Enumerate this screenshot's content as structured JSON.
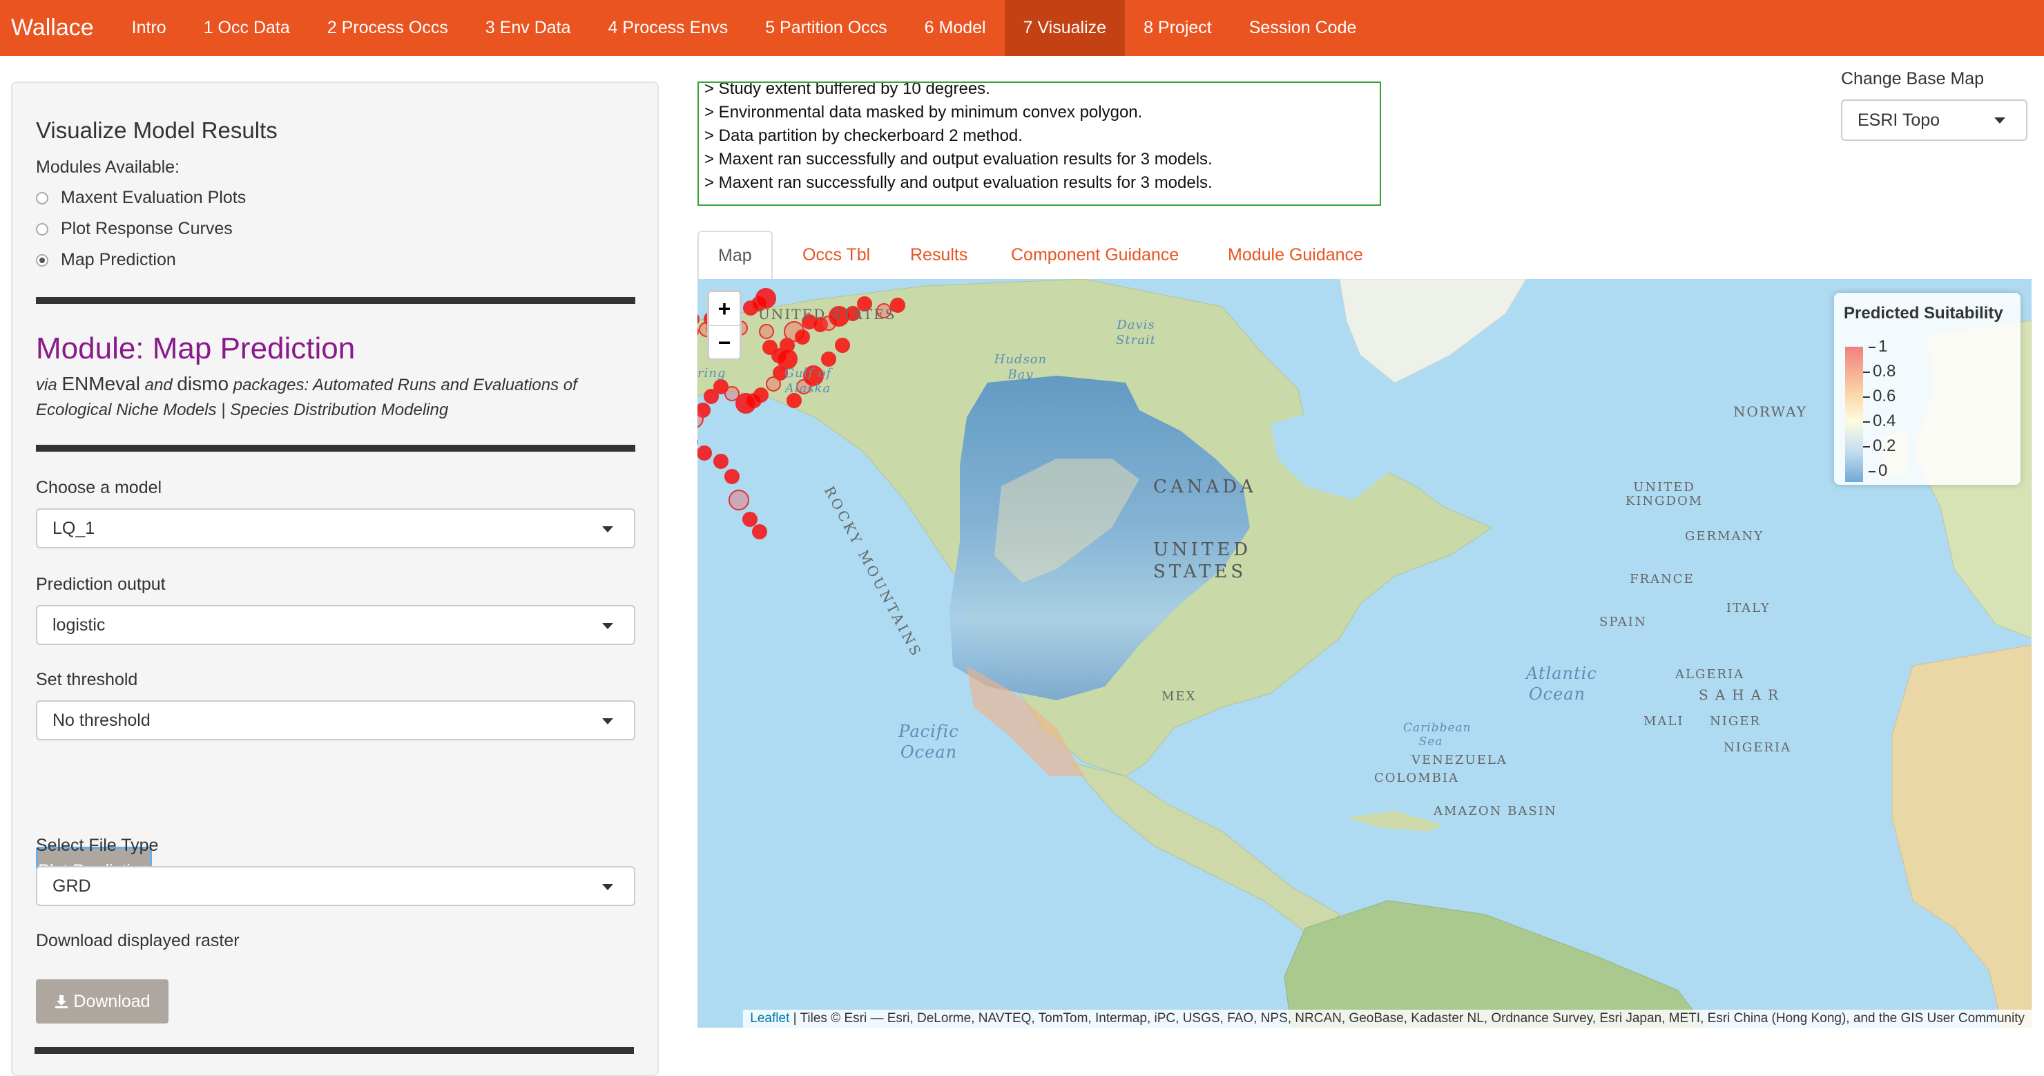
{
  "navbar": {
    "brand": "Wallace",
    "items": [
      "Intro",
      "1 Occ Data",
      "2 Process Occs",
      "3 Env Data",
      "4 Process Envs",
      "5 Partition Occs",
      "6 Model",
      "7 Visualize",
      "8 Project",
      "Session Code"
    ],
    "active_index": 7
  },
  "sidebar": {
    "title": "Visualize Model Results",
    "modules_label": "Modules Available:",
    "modules": [
      "Maxent Evaluation Plots",
      "Plot Response Curves",
      "Map Prediction"
    ],
    "selected_module": "Map Prediction",
    "module_heading": "Module: Map Prediction",
    "module_sub": {
      "via": "via",
      "pkg1": "ENMeval",
      "and": "and",
      "pkg2": "dismo",
      "rest": "packages: Automated Runs and Evaluations of Ecological Niche Models | Species Distribution Modeling"
    },
    "model_label": "Choose a model",
    "model_value": "LQ_1",
    "output_label": "Prediction output",
    "output_value": "logistic",
    "threshold_label": "Set threshold",
    "threshold_value": "No threshold",
    "plot_button": "Plot Prediction",
    "filetype_label": "Select File Type",
    "filetype_value": "GRD",
    "download_label": "Download displayed raster",
    "download_button": "Download"
  },
  "log": [
    "> Study extent buffered by 10 degrees.",
    "> Environmental data masked by minimum convex polygon.",
    "> Data partition by checkerboard 2 method.",
    "> Maxent ran successfully and output evaluation results for 3 models.",
    "> Maxent ran successfully and output evaluation results for 3 models."
  ],
  "basemap": {
    "label": "Change Base Map",
    "value": "ESRI Topo"
  },
  "tabs": [
    "Map",
    "Occs Tbl",
    "Results",
    "Component Guidance",
    "Module Guidance"
  ],
  "active_tab": "Map",
  "map": {
    "zoom_in": "+",
    "zoom_out": "−",
    "legend_title": "Predicted Suitability",
    "legend_ticks": [
      "1",
      "0.8",
      "0.6",
      "0.4",
      "0.2",
      "0"
    ],
    "attribution_link": "Leaflet",
    "attribution_text": " | Tiles © Esri — Esri, DeLorme, NAVTEQ, TomTom, Intermap, iPC, USGS, FAO, NPS, NRCAN, GeoBase, Kadaster NL, Ordnance Survey, Esri Japan, METI, Esri China (Hong Kong), and the GIS User Community",
    "labels": {
      "canada": "CANADA",
      "united_states": "UNITED STATES",
      "us_alaska": "UNITED STATES",
      "rocky": "ROCKY MOUNTAINS",
      "gulf_alaska": "Gulf of Alaska",
      "hudson": "Hudson Bay",
      "davis": "Davis Strait",
      "norway": "NORWAY",
      "uk": "UNITED KINGDOM",
      "germany": "GERMANY",
      "france": "FRANCE",
      "italy": "ITALY",
      "spain": "SPAIN",
      "algeria": "ALGERIA",
      "sahara": "SAHAR",
      "mali": "MALI",
      "niger": "NIGER",
      "nigeria": "NIGERIA",
      "atlantic": "Atlantic Ocean",
      "pacific": "Pacific Ocean",
      "caribbean": "Caribbean Sea",
      "mexico": "MEX",
      "venezuela": "VENEZUELA",
      "colombia": "COLOMBIA",
      "amazon": "AMAZON BASIN",
      "bering": "ring"
    }
  }
}
